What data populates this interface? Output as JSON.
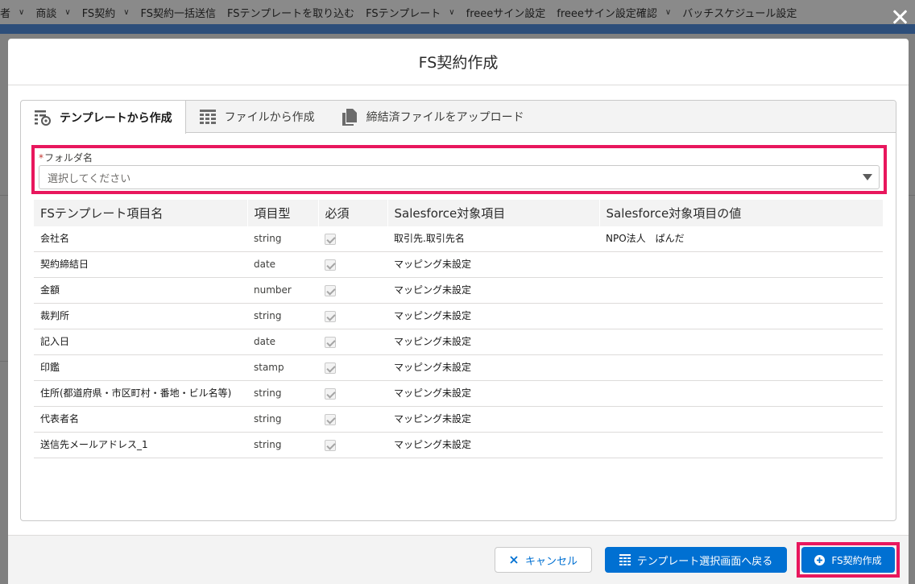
{
  "background_nav": {
    "items": [
      {
        "label": "者",
        "chevron": true
      },
      {
        "label": "商談",
        "chevron": true
      },
      {
        "label": "FS契約",
        "chevron": true
      },
      {
        "label": "FS契約一括送信",
        "chevron": false
      },
      {
        "label": "FSテンプレートを取り込む",
        "chevron": false
      },
      {
        "label": "FSテンプレート",
        "chevron": true
      },
      {
        "label": "freeeサイン設定",
        "chevron": false
      },
      {
        "label": "freeeサイン設定確認",
        "chevron": true
      },
      {
        "label": "バッチスケジュール設定",
        "chevron": false
      }
    ]
  },
  "modal": {
    "title": "FS契約作成",
    "tabs": [
      {
        "label": "テンプレートから作成",
        "icon": "template-settings-icon",
        "active": true
      },
      {
        "label": "ファイルから作成",
        "icon": "table-grid-icon",
        "active": false
      },
      {
        "label": "締結済ファイルをアップロード",
        "icon": "copy-files-icon",
        "active": false
      }
    ],
    "folder": {
      "required_mark": "*",
      "label": "フォルダ名",
      "placeholder": "選択してください"
    },
    "table": {
      "headers": [
        "FSテンプレート項目名",
        "項目型",
        "必須",
        "Salesforce対象項目",
        "Salesforce対象項目の値"
      ],
      "rows": [
        {
          "name": "会社名",
          "type": "string",
          "required": true,
          "target": "取引先.取引先名",
          "value": "NPO法人　ぱんだ"
        },
        {
          "name": "契約締結日",
          "type": "date",
          "required": true,
          "target": "マッピング未設定",
          "value": ""
        },
        {
          "name": "金額",
          "type": "number",
          "required": true,
          "target": "マッピング未設定",
          "value": ""
        },
        {
          "name": "裁判所",
          "type": "string",
          "required": true,
          "target": "マッピング未設定",
          "value": ""
        },
        {
          "name": "記入日",
          "type": "date",
          "required": true,
          "target": "マッピング未設定",
          "value": ""
        },
        {
          "name": "印鑑",
          "type": "stamp",
          "required": true,
          "target": "マッピング未設定",
          "value": ""
        },
        {
          "name": "住所(都道府県・市区町村・番地・ビル名等)",
          "type": "string",
          "required": true,
          "target": "マッピング未設定",
          "value": ""
        },
        {
          "name": "代表者名",
          "type": "string",
          "required": true,
          "target": "マッピング未設定",
          "value": ""
        },
        {
          "name": "送信先メールアドレス_1",
          "type": "string",
          "required": true,
          "target": "マッピング未設定",
          "value": ""
        }
      ]
    },
    "footer": {
      "cancel_label": "キャンセル",
      "back_label": "テンプレート選択画面へ戻る",
      "create_label": "FS契約作成"
    }
  },
  "colors": {
    "brand_blue": "#0070d2",
    "highlight": "#e8175d"
  }
}
